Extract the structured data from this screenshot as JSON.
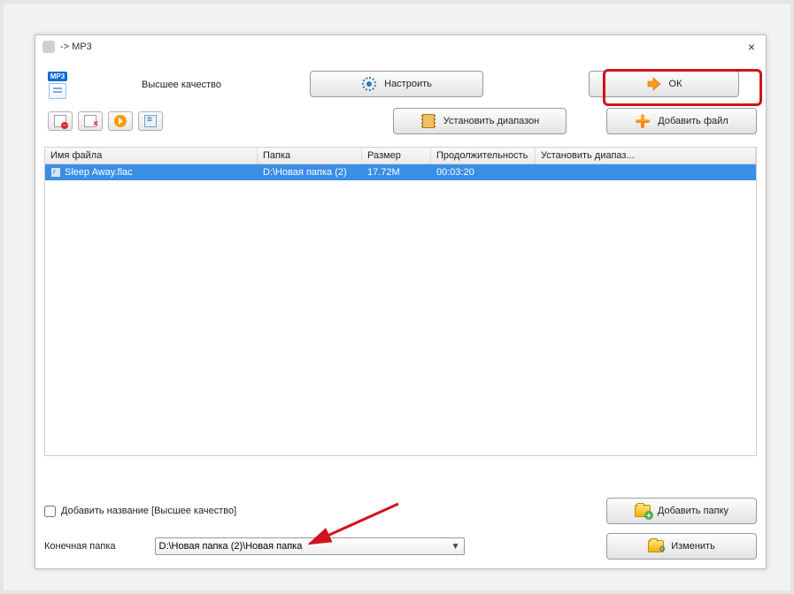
{
  "window": {
    "title": "-> MP3",
    "quality_label": "Высшее качество"
  },
  "buttons": {
    "configure": "Настроить",
    "set_range": "Установить диапазон",
    "ok": "ОК",
    "add_file": "Добавить файл",
    "add_folder": "Добавить папку",
    "change": "Изменить"
  },
  "table": {
    "headers": {
      "name": "Имя файла",
      "folder": "Папка",
      "size": "Размер",
      "duration": "Продолжительность",
      "range": "Установить диапаз..."
    },
    "rows": [
      {
        "name": "Sleep Away.flac",
        "folder": "D:\\Новая папка (2)",
        "size": "17.72M",
        "duration": "00:03:20",
        "range": ""
      }
    ]
  },
  "bottom": {
    "add_title_label": "Добавить название [Высшее качество]",
    "dest_label": "Конечная папка",
    "dest_value": "D:\\Новая папка (2)\\Новая папка"
  }
}
